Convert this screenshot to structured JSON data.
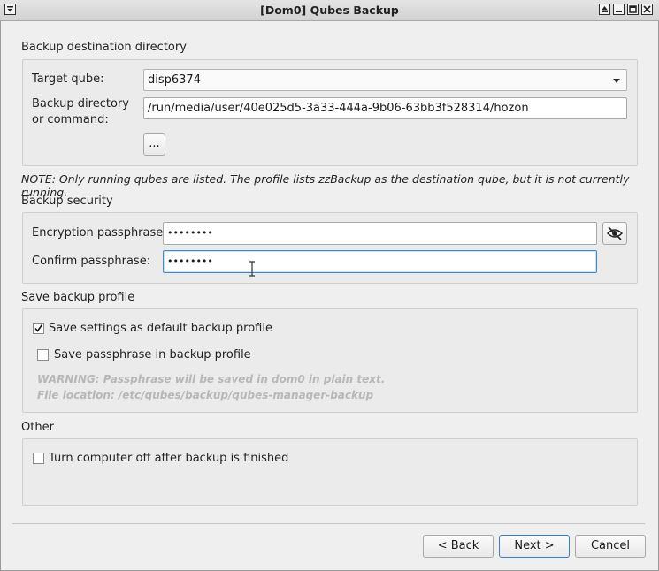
{
  "window": {
    "title": "[Dom0] Qubes Backup",
    "menu_icon": "window-menu-icon",
    "controls": [
      "shade-icon",
      "minimize-icon",
      "maximize-icon",
      "close-icon"
    ]
  },
  "destination": {
    "section_title": "Backup destination directory",
    "target_label": "Target qube:",
    "target_value": "disp6374",
    "dir_label_line1": "Backup directory",
    "dir_label_line2": "or command:",
    "dir_value": "/run/media/user/40e025d5-3a33-444a-9b06-63bb3f528314/hozon",
    "browse_label": "..."
  },
  "note": "NOTE: Only running qubes are listed. The profile lists zzBackup as the destination qube, but it is not currently running.",
  "security": {
    "section_title": "Backup security",
    "encryption_label": "Encryption passphrase:",
    "encryption_value": "••••••••",
    "confirm_label": "Confirm passphrase:",
    "confirm_value": "••••••••",
    "reveal_icon": "eye-slash-icon"
  },
  "profile": {
    "section_title": "Save backup profile",
    "save_default_label": "Save settings as default backup profile",
    "save_default_checked": true,
    "save_pass_label": "Save passphrase in backup profile",
    "save_pass_checked": false,
    "warning_line1": "WARNING: Passphrase will be saved in dom0 in plain text.",
    "warning_line2": "File location: /etc/qubes/backup/qubes-manager-backup"
  },
  "other": {
    "section_title": "Other",
    "turn_off_label": "Turn computer off after backup is finished",
    "turn_off_checked": false
  },
  "footer": {
    "back_label": "< Back",
    "next_label": "Next >",
    "cancel_label": "Cancel"
  },
  "colors": {
    "focus_accent": "#3a8bd0",
    "warning_text": "#b7b7b7"
  }
}
